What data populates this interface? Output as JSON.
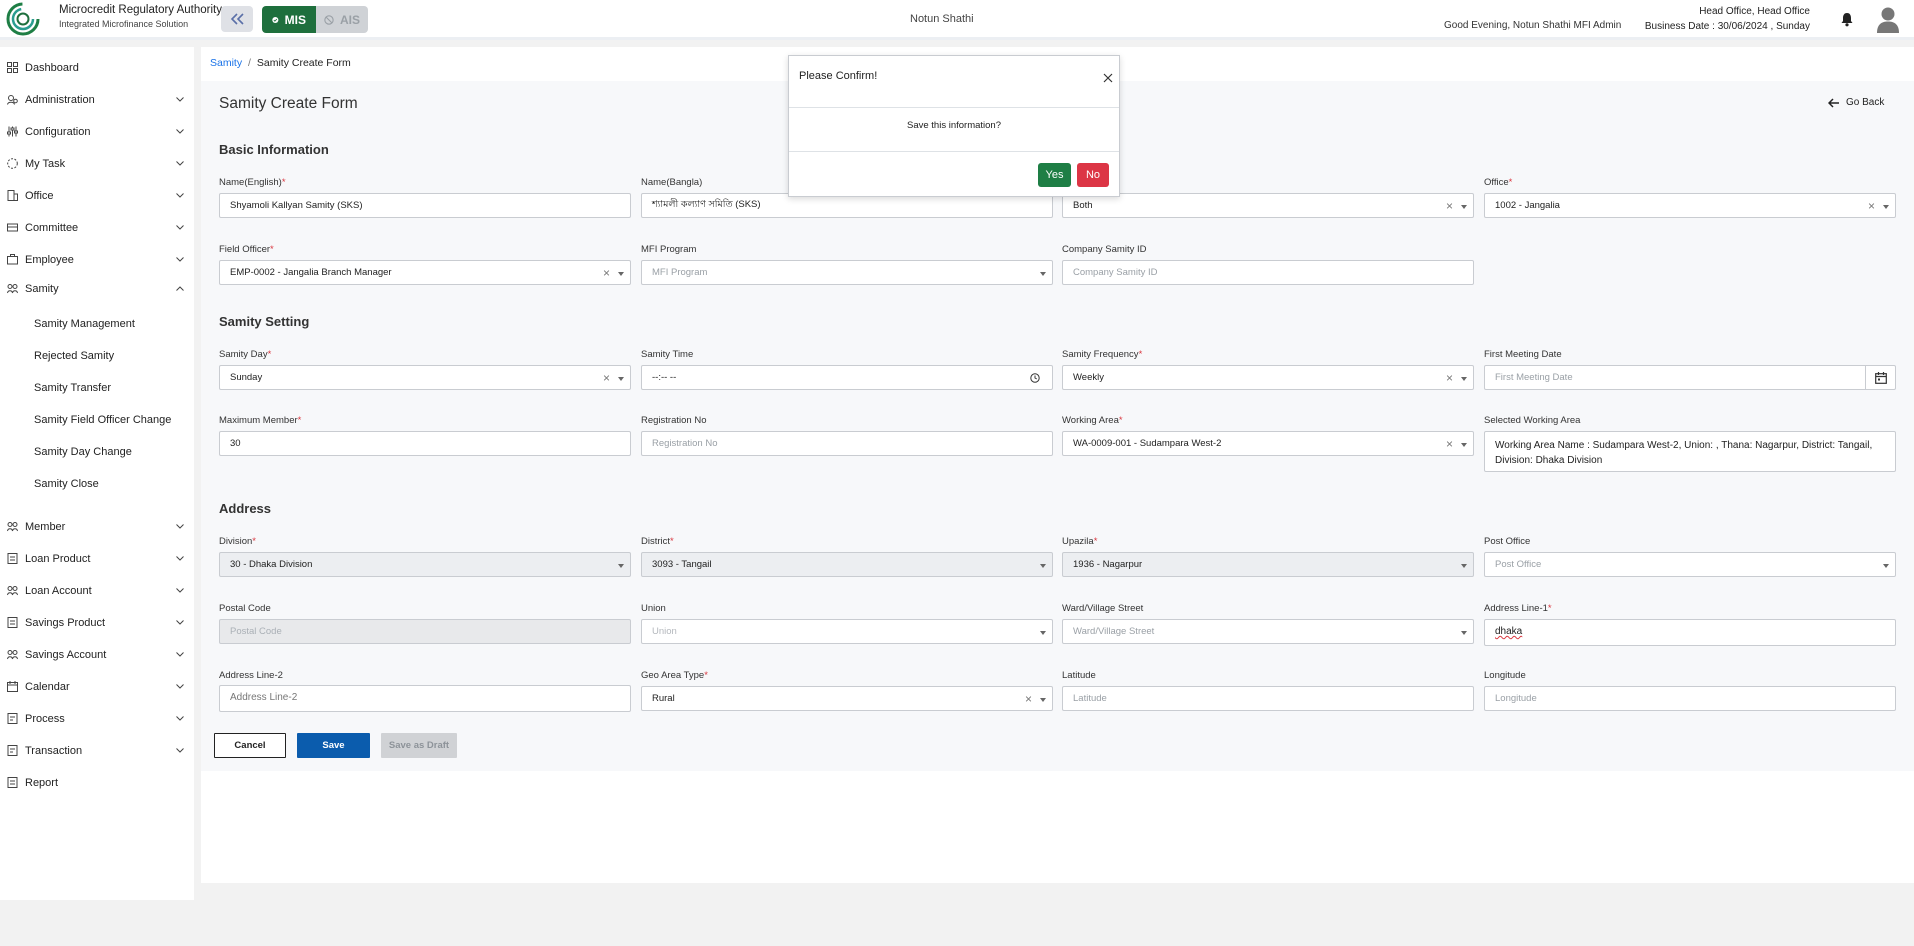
{
  "header": {
    "org_name": "Microcredit Regulatory Authority",
    "org_sub": "Integrated Microfinance Solution",
    "logo_text": "Microcredit Regulatory Authority",
    "mis_label": "MIS",
    "ais_label": "AIS",
    "app_title": "Notun Shathi",
    "greeting": "Good Evening, Notun Shathi MFI Admin",
    "office": "Head Office, Head Office",
    "business_date": "Business Date : 30/06/2024 , Sunday"
  },
  "sidebar": {
    "items": [
      {
        "label": "Dashboard",
        "icon": "dashboard-icon"
      },
      {
        "label": "Administration",
        "icon": "administration-icon"
      },
      {
        "label": "Configuration",
        "icon": "configuration-icon"
      },
      {
        "label": "My Task",
        "icon": "task-icon"
      },
      {
        "label": "Office",
        "icon": "office-icon"
      },
      {
        "label": "Committee",
        "icon": "committee-icon"
      },
      {
        "label": "Employee",
        "icon": "employee-icon"
      },
      {
        "label": "Samity",
        "icon": "samity-icon"
      },
      {
        "label": "Member",
        "icon": "member-icon"
      },
      {
        "label": "Loan Product",
        "icon": "loan-product-icon"
      },
      {
        "label": "Loan Account",
        "icon": "loan-account-icon"
      },
      {
        "label": "Savings Product",
        "icon": "savings-product-icon"
      },
      {
        "label": "Savings Account",
        "icon": "savings-account-icon"
      },
      {
        "label": "Calendar",
        "icon": "calendar-icon"
      },
      {
        "label": "Process",
        "icon": "process-icon"
      },
      {
        "label": "Transaction",
        "icon": "transaction-icon"
      },
      {
        "label": "Report",
        "icon": "report-icon"
      }
    ],
    "samity_sub": [
      "Samity Management",
      "Rejected Samity",
      "Samity Transfer",
      "Samity Field Officer Change",
      "Samity Day Change",
      "Samity Close"
    ]
  },
  "breadcrumb": {
    "root": "Samity",
    "sep": "/",
    "current": "Samity Create Form"
  },
  "page": {
    "title": "Samity Create Form",
    "go_back": "Go Back"
  },
  "form": {
    "basic_title": "Basic Information",
    "name_en": {
      "label": "Name(English)",
      "value": "Shyamoli Kallyan Samity (SKS)"
    },
    "name_bn": {
      "label": "Name(Bangla)",
      "value": "শ্যামলী কল্যাণ সমিতি (SKS)"
    },
    "samity_type": {
      "value": "Both"
    },
    "office": {
      "label": "Office",
      "value": "1002 - Jangalia"
    },
    "field_officer": {
      "label": "Field Officer",
      "value": "EMP-0002 - Jangalia Branch Manager"
    },
    "mfi_program": {
      "label": "MFI Program",
      "placeholder": "MFI Program"
    },
    "company_samity_id": {
      "label": "Company Samity ID",
      "placeholder": "Company Samity ID"
    },
    "setting_title": "Samity Setting",
    "samity_day": {
      "label": "Samity Day",
      "value": "Sunday"
    },
    "samity_time": {
      "label": "Samity Time",
      "value": "--:-- --"
    },
    "samity_frequency": {
      "label": "Samity Frequency",
      "value": "Weekly"
    },
    "first_meeting": {
      "label": "First Meeting Date",
      "placeholder": "First Meeting Date"
    },
    "max_member": {
      "label": "Maximum Member",
      "value": "30"
    },
    "registration_no": {
      "label": "Registration No",
      "placeholder": "Registration No"
    },
    "working_area": {
      "label": "Working Area",
      "value": "WA-0009-001 - Sudampara West-2"
    },
    "selected_working_area": {
      "label": "Selected Working Area",
      "value": "Working Area Name : Sudampara West-2, Union: , Thana:  Nagarpur, District: Tangail, Division: Dhaka Division"
    },
    "address_title": "Address",
    "division": {
      "label": "Division",
      "value": "30 - Dhaka Division"
    },
    "district": {
      "label": "District",
      "value": "3093 - Tangail"
    },
    "upazila": {
      "label": "Upazila",
      "value": "1936 - Nagarpur"
    },
    "post_office": {
      "label": "Post Office",
      "placeholder": "Post Office"
    },
    "postal_code": {
      "label": "Postal Code",
      "placeholder": "Postal Code"
    },
    "union": {
      "label": "Union",
      "placeholder": "Union"
    },
    "ward": {
      "label": "Ward/Village Street",
      "placeholder": "Ward/Village Street"
    },
    "address1": {
      "label": "Address Line-1",
      "value": "dhaka"
    },
    "address2": {
      "label": "Address Line-2",
      "placeholder": "Address Line-2"
    },
    "geo_area": {
      "label": "Geo Area Type",
      "value": "Rural"
    },
    "latitude": {
      "label": "Latitude",
      "placeholder": "Latitude"
    },
    "longitude": {
      "label": "Longitude",
      "placeholder": "Longitude"
    },
    "req_mark": "*",
    "clear_mark": "×"
  },
  "buttons": {
    "cancel": "Cancel",
    "save": "Save",
    "save_draft": "Save as Draft"
  },
  "modal": {
    "title": "Please Confirm!",
    "body": "Save this information?",
    "yes": "Yes",
    "no": "No"
  },
  "colors": {
    "brand_green": "#1e6f3d",
    "link_blue": "#1a73e8",
    "save_blue": "#0b5cad",
    "danger": "#dc3545"
  }
}
